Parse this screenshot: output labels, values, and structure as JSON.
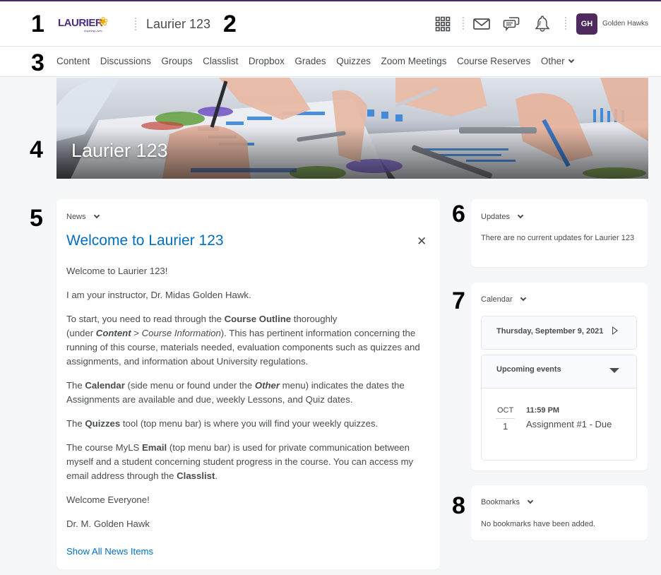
{
  "annotations": [
    "1",
    "2",
    "3",
    "4",
    "5",
    "6",
    "7",
    "8"
  ],
  "header": {
    "logo_text": "LAURIER",
    "logo_tagline": "Inspiring Lives.",
    "course_title": "Laurier 123",
    "icons": [
      "app-grid-icon",
      "mail-icon",
      "chat-icon",
      "bell-icon"
    ],
    "avatar_initials": "GH",
    "user_name": "Golden Hawks",
    "accent_color": "#4f2a5f"
  },
  "nav": {
    "items": [
      "Content",
      "Discussions",
      "Groups",
      "Classlist",
      "Dropbox",
      "Grades",
      "Quizzes",
      "Zoom Meetings",
      "Course Reserves"
    ],
    "more_label": "Other"
  },
  "banner": {
    "title": "Laurier 123"
  },
  "news": {
    "widget_label": "News",
    "title": "Welcome to Laurier 123",
    "paragraphs": {
      "p1": "Welcome to Laurier 123!",
      "p2": "I am your instructor, Dr. Midas Golden Hawk.",
      "p3_a": "To start, you need to read through the ",
      "p3_b": "Course Outline",
      "p3_c": " thoroughly",
      "p3_d": "(under ",
      "p3_e": "Content",
      "p3_f": " > ",
      "p3_g": "Course Information",
      "p3_h": "). This has pertinent information concerning the running of this course, materials needed, evaluation components such as quizzes and assignments, and information about University regulations.",
      "p4_a": "The ",
      "p4_b": "Calendar",
      "p4_c": " (side menu or found under the ",
      "p4_d": "Other",
      "p4_e": " menu) indicates the dates the Assignments are available and due, weekly Lessons, and Quiz dates.",
      "p5_a": "The ",
      "p5_b": "Quizzes",
      "p5_c": " tool (top menu bar) is where you will find your weekly quizzes.",
      "p6_a": "The course MyLS ",
      "p6_b": "Email",
      "p6_c": " (top menu bar) is used for private communication between myself and a student concerning student progress in the course.  You can access my email address through the ",
      "p6_d": "Classlist",
      "p6_e": ".",
      "p7": "Welcome Everyone!",
      "p8": "Dr. M. Golden Hawk"
    },
    "show_all_label": "Show All News Items",
    "link_color": "#006fbf"
  },
  "updates": {
    "widget_label": "Updates",
    "message": "There are no current updates for Laurier 123"
  },
  "calendar": {
    "widget_label": "Calendar",
    "current_date": "Thursday, September 9, 2021",
    "upcoming_label": "Upcoming events",
    "events": [
      {
        "month": "OCT",
        "day": "1",
        "time": "11:59 PM",
        "title": "Assignment #1 - Due"
      }
    ]
  },
  "bookmarks": {
    "widget_label": "Bookmarks",
    "message": "No bookmarks have been added."
  }
}
